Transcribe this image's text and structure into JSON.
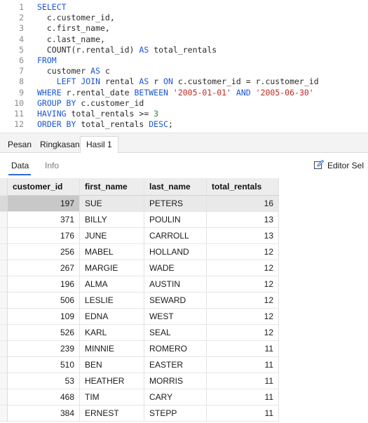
{
  "editor": {
    "lines": [
      {
        "n": "1",
        "segs": [
          {
            "t": "SELECT",
            "c": "kw"
          }
        ]
      },
      {
        "n": "2",
        "segs": [
          {
            "t": "  c.customer_id,",
            "c": ""
          }
        ]
      },
      {
        "n": "3",
        "segs": [
          {
            "t": "  c.first_name,",
            "c": ""
          }
        ]
      },
      {
        "n": "4",
        "segs": [
          {
            "t": "  c.last_name,",
            "c": ""
          }
        ]
      },
      {
        "n": "5",
        "segs": [
          {
            "t": "  COUNT(r.rental_id) ",
            "c": ""
          },
          {
            "t": "AS",
            "c": "kw"
          },
          {
            "t": " total_rentals",
            "c": ""
          }
        ]
      },
      {
        "n": "6",
        "segs": [
          {
            "t": "FROM",
            "c": "kw"
          }
        ]
      },
      {
        "n": "7",
        "segs": [
          {
            "t": "  customer ",
            "c": ""
          },
          {
            "t": "AS",
            "c": "kw"
          },
          {
            "t": " c",
            "c": ""
          }
        ]
      },
      {
        "n": "8",
        "segs": [
          {
            "t": "    ",
            "c": ""
          },
          {
            "t": "LEFT JOIN",
            "c": "kw"
          },
          {
            "t": " rental ",
            "c": ""
          },
          {
            "t": "AS",
            "c": "kw"
          },
          {
            "t": " r ",
            "c": ""
          },
          {
            "t": "ON",
            "c": "kw"
          },
          {
            "t": " c.customer_id = r.customer_id",
            "c": ""
          }
        ]
      },
      {
        "n": "9",
        "segs": [
          {
            "t": "WHERE",
            "c": "kw"
          },
          {
            "t": " r.rental_date ",
            "c": ""
          },
          {
            "t": "BETWEEN",
            "c": "kw"
          },
          {
            "t": " ",
            "c": ""
          },
          {
            "t": "'2005-01-01'",
            "c": "str"
          },
          {
            "t": " ",
            "c": ""
          },
          {
            "t": "AND",
            "c": "kw"
          },
          {
            "t": " ",
            "c": ""
          },
          {
            "t": "'2005-06-30'",
            "c": "str"
          }
        ]
      },
      {
        "n": "10",
        "segs": [
          {
            "t": "GROUP BY",
            "c": "kw"
          },
          {
            "t": " c.customer_id",
            "c": ""
          }
        ]
      },
      {
        "n": "11",
        "segs": [
          {
            "t": "HAVING",
            "c": "kw"
          },
          {
            "t": " total_rentals >= ",
            "c": ""
          },
          {
            "t": "3",
            "c": "num"
          }
        ]
      },
      {
        "n": "12",
        "segs": [
          {
            "t": "ORDER BY",
            "c": "kw"
          },
          {
            "t": " total_rentals ",
            "c": ""
          },
          {
            "t": "DESC",
            "c": "kw"
          },
          {
            "t": ";",
            "c": ""
          }
        ]
      }
    ]
  },
  "tabs": [
    {
      "label": "Pesan",
      "active": false
    },
    {
      "label": "Ringkasan",
      "active": false
    },
    {
      "label": "Hasil 1",
      "active": true
    }
  ],
  "subtabs": {
    "data": "Data",
    "info": "Info"
  },
  "edit_button": "Editor Sel",
  "grid": {
    "columns": [
      "customer_id",
      "first_name",
      "last_name",
      "total_rentals"
    ],
    "rows": [
      [
        "197",
        "SUE",
        "PETERS",
        "16"
      ],
      [
        "371",
        "BILLY",
        "POULIN",
        "13"
      ],
      [
        "176",
        "JUNE",
        "CARROLL",
        "13"
      ],
      [
        "256",
        "MABEL",
        "HOLLAND",
        "12"
      ],
      [
        "267",
        "MARGIE",
        "WADE",
        "12"
      ],
      [
        "196",
        "ALMA",
        "AUSTIN",
        "12"
      ],
      [
        "506",
        "LESLIE",
        "SEWARD",
        "12"
      ],
      [
        "109",
        "EDNA",
        "WEST",
        "12"
      ],
      [
        "526",
        "KARL",
        "SEAL",
        "12"
      ],
      [
        "239",
        "MINNIE",
        "ROMERO",
        "11"
      ],
      [
        "510",
        "BEN",
        "EASTER",
        "11"
      ],
      [
        "53",
        "HEATHER",
        "MORRIS",
        "11"
      ],
      [
        "468",
        "TIM",
        "CARY",
        "11"
      ],
      [
        "384",
        "ERNEST",
        "STEPP",
        "11"
      ]
    ]
  }
}
